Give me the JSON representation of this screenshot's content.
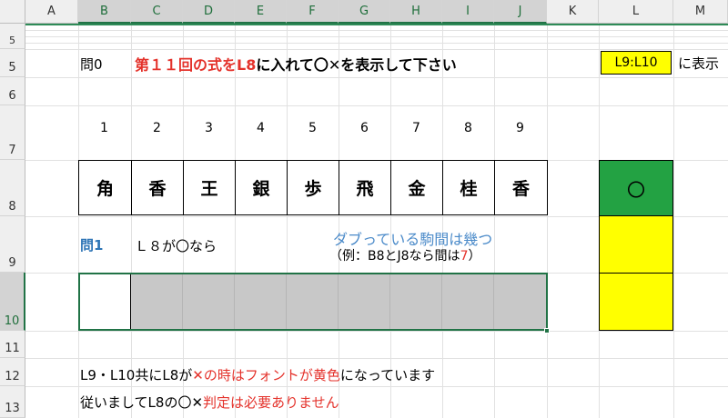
{
  "columns": [
    "A",
    "B",
    "C",
    "D",
    "E",
    "F",
    "G",
    "H",
    "I",
    "J",
    "K",
    "L",
    "M"
  ],
  "rows": [
    "5",
    "5",
    "6",
    "7",
    "8",
    "9",
    "10",
    "11",
    "12",
    "13"
  ],
  "q0": {
    "label": "問0",
    "instruction_red": "第１１回の式をL8",
    "instruction_black": "に入れて〇✕を表示して下さい",
    "range_box": "L9:L10",
    "range_suffix": "に表示"
  },
  "numbers": [
    "1",
    "2",
    "3",
    "4",
    "5",
    "6",
    "7",
    "8",
    "9"
  ],
  "pieces": [
    "角",
    "香",
    "王",
    "銀",
    "歩",
    "飛",
    "金",
    "桂",
    "香"
  ],
  "result": {
    "mark": "〇"
  },
  "q1": {
    "label": "問1",
    "condition": "Ｌ８が〇なら",
    "question": "ダブっている駒間は幾つ",
    "example_pre": "（例：B8とJ8なら間は",
    "example_num": "7",
    "example_post": "）"
  },
  "notes": {
    "line1_a": "L9・L10共にL8が",
    "line1_b": "✕の時はフォントが",
    "line1_c": "黄色",
    "line1_d": "になっています",
    "line2_a": "従いましてL8の〇✕",
    "line2_b": "判定は必要ありません"
  },
  "colors": {
    "green": "#23a243",
    "yellow": "#ffff00",
    "red": "#e4322b",
    "blue": "#2e75b6",
    "gray": "#c8c8c8"
  }
}
